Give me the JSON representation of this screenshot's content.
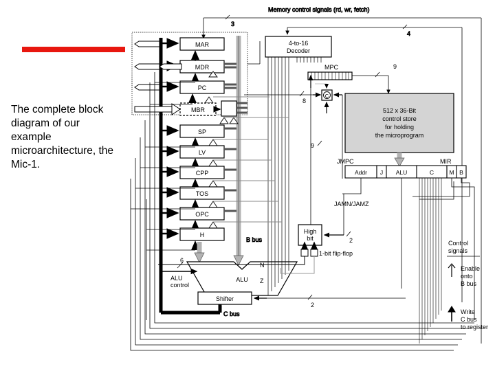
{
  "slide": {
    "caption": "The complete block\ndiagram of our example microarchitecture, the Mic-1.",
    "accent_color": "#e8170f"
  },
  "diagram": {
    "title_top": "Memory control signals (rd, wr, fetch)",
    "registers": [
      "MAR",
      "MDR",
      "PC",
      "MBR",
      "SP",
      "LV",
      "CPP",
      "TOS",
      "OPC",
      "H"
    ],
    "buses": {
      "b_bus": "B bus",
      "c_bus": "C bus"
    },
    "alu": {
      "label": "ALU",
      "control_label": "ALU\ncontrol",
      "control_bits": "6",
      "n_flag": "N",
      "z_flag": "Z"
    },
    "shifter": "Shifter",
    "decoder": "4-to-16\nDecoder",
    "mpc": "MPC",
    "incrementer": "C",
    "control_store": "512 x 36-Bit\ncontrol store\nfor holding\nthe microprogram",
    "mir": {
      "label": "MIR",
      "fields": [
        "Addr",
        "J",
        "ALU",
        "C",
        "M",
        "B"
      ]
    },
    "jmpc": "JMPC",
    "jamn_jamz": "JAMN/JAMZ",
    "high_bit": "High\nbit",
    "flipflop": "1-bit flip-flop",
    "wire_labels": {
      "w3": "3",
      "w4": "4",
      "w9a": "9",
      "w9b": "9",
      "w8": "8",
      "w2a": "2",
      "w2b": "2"
    },
    "legend": {
      "title": "Control\nsignals",
      "enable": "Enable\nonto\nB bus",
      "write": "Write\nC bus\nto register"
    }
  }
}
